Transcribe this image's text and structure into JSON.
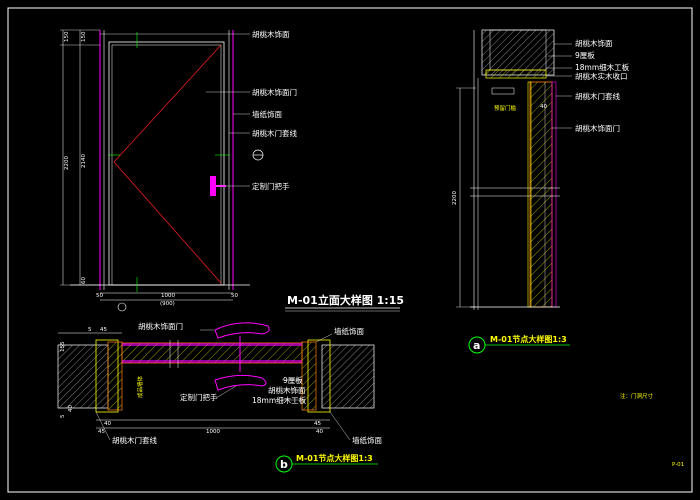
{
  "titles": {
    "elevation": "M-01立面大样图 1:15",
    "section_a": "M-01节点大样图1:3",
    "section_b": "M-01节点大样图1:3",
    "marker_a": "a",
    "marker_b": "b"
  },
  "elevation_labels": {
    "l1": "胡桃木饰面",
    "l2": "胡桃木饰面门",
    "l3": "墙纸饰面",
    "l4": "胡桃木门套线",
    "l5": "定制门把手"
  },
  "elevation_dims": {
    "h1": "150",
    "h2": "150",
    "h_total": "2200",
    "h_door": "2140",
    "h_bottom": "60",
    "w_left": "50",
    "w_door": "1000",
    "w_total": "(900)",
    "w_right": "50"
  },
  "section_a_labels": {
    "l1": "胡桃木饰面",
    "l2": "9厘板",
    "l3": "18mm细木工板",
    "l4": "胡桃木实木收口",
    "l5": "胡桃木门套线",
    "l6": "胡桃木饰面门",
    "note": "预留门槛",
    "dim_h": "2200",
    "dim_small": "40"
  },
  "section_b_labels": {
    "l1": "胡桃木饰面门",
    "l2": "墙纸饰面",
    "l3": "定制门把手",
    "l4": "9厘板",
    "l5": "胡桃木饰面",
    "l6": "18mm细木工板",
    "l7": "墙纸饰面",
    "l8": "胡桃木门套线",
    "wall": "成品墙体",
    "d1": "5",
    "d2": "45",
    "d3": "155",
    "d4": "40",
    "d5": "1000",
    "d6": "45",
    "d7": "40",
    "d8": "45",
    "d9": "5",
    "d10": "40"
  },
  "legend_note": "注：门洞尺寸",
  "page_no": "P-01",
  "colors": {
    "frame": "#ffffff",
    "magenta": "#ff00ff",
    "yellow": "#ffff00",
    "orange": "#ff8000",
    "green": "#00ff00",
    "red": "#ff2020"
  }
}
